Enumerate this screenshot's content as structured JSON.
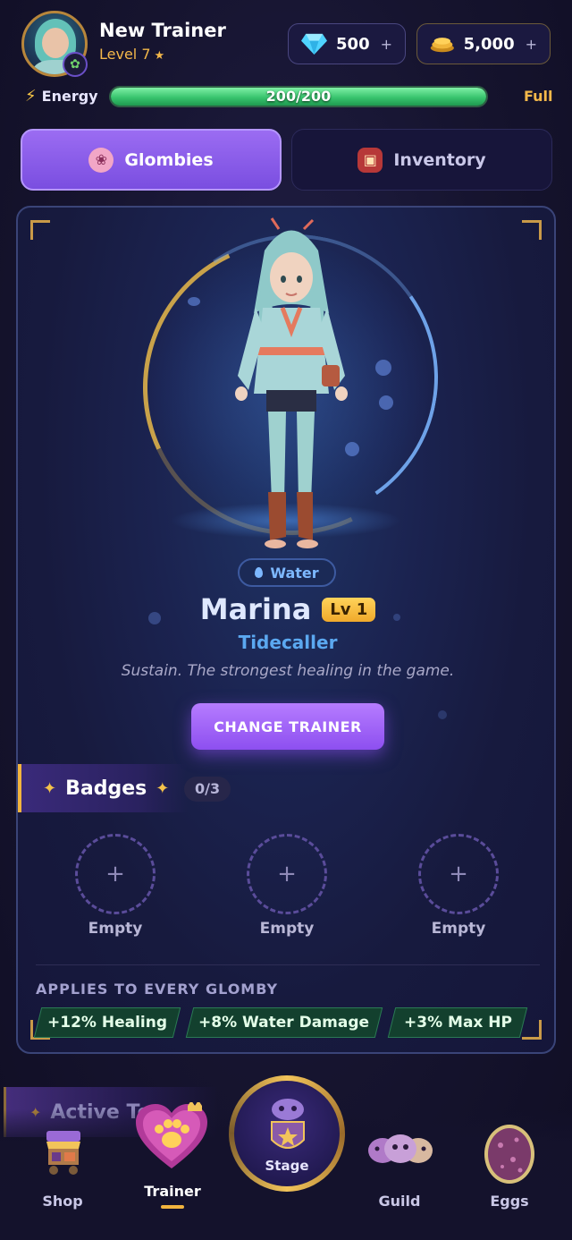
{
  "header": {
    "trainer_name": "New Trainer",
    "trainer_level": "Level 7",
    "gems": "500",
    "gold": "5,000",
    "energy_label": "Energy",
    "energy_value": "200/200",
    "energy_fraction": 1.0,
    "energy_status": "Full"
  },
  "tabs": [
    {
      "label": "Glombies",
      "active": true
    },
    {
      "label": "Inventory",
      "active": false
    }
  ],
  "character": {
    "element": "Water",
    "name": "Marina",
    "level": "Lv 1",
    "class": "Tidecaller",
    "description": "Sustain. The strongest healing in the game.",
    "change_button": "CHANGE TRAINER"
  },
  "badges": {
    "title": "Badges",
    "count": "0/3",
    "slots": [
      {
        "label": "Empty"
      },
      {
        "label": "Empty"
      },
      {
        "label": "Empty"
      }
    ]
  },
  "applies": {
    "title": "APPLIES TO EVERY GLOMBY",
    "buffs": [
      "+12% Healing",
      "+8% Water Damage",
      "+3% Max HP"
    ]
  },
  "nav": {
    "active_team_label": "Active Te",
    "items": [
      {
        "label": "Shop",
        "icon": "shop-cart-icon"
      },
      {
        "label": "Trainer",
        "icon": "paw-heart-icon",
        "active": true
      },
      {
        "label": "Stage",
        "icon": "stage-shield-icon"
      },
      {
        "label": "Guild",
        "icon": "guild-masks-icon"
      },
      {
        "label": "Eggs",
        "icon": "egg-icon"
      }
    ]
  },
  "colors": {
    "accent_purple": "#8d4ff0",
    "gold": "#f4b84a",
    "energy_green": "#38c46e",
    "water_blue": "#5ba8f0"
  }
}
